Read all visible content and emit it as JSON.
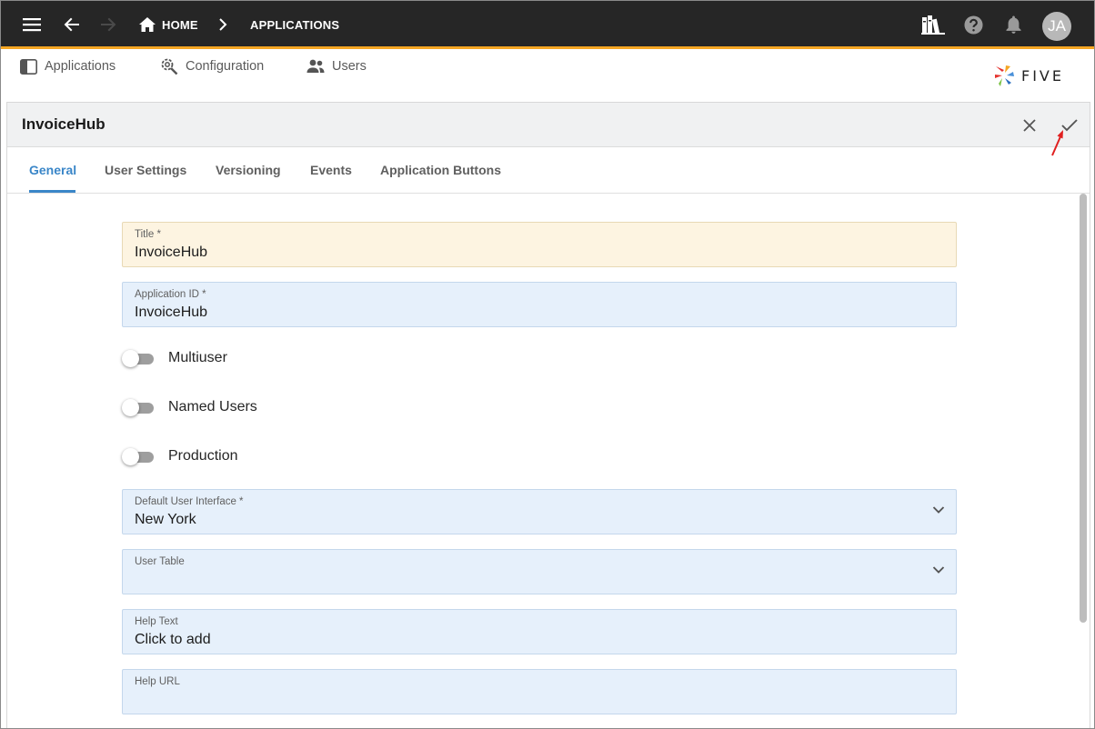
{
  "topbar": {
    "icons": [
      "menu-icon",
      "arrow-back-icon",
      "arrow-forward-icon",
      "home-icon",
      "library-icon",
      "help-icon",
      "notifications-icon"
    ],
    "breadcrumb": {
      "home": "HOME",
      "current": "APPLICATIONS"
    },
    "avatar_initials": "JA",
    "accent_color": "#f5a623"
  },
  "subnav": {
    "items": [
      {
        "label": "Applications",
        "icon": "applications-icon"
      },
      {
        "label": "Configuration",
        "icon": "configuration-icon"
      },
      {
        "label": "Users",
        "icon": "users-icon"
      }
    ],
    "logo_text": "FIVE"
  },
  "panel": {
    "title": "InvoiceHub",
    "actions": [
      "close-icon",
      "check-icon"
    ],
    "tabs": [
      {
        "label": "General",
        "active": true
      },
      {
        "label": "User Settings",
        "active": false
      },
      {
        "label": "Versioning",
        "active": false
      },
      {
        "label": "Events",
        "active": false
      },
      {
        "label": "Application Buttons",
        "active": false
      }
    ],
    "tab_active_color": "#3a86c8"
  },
  "form": {
    "title": {
      "label": "Title *",
      "value": "InvoiceHub"
    },
    "application_id": {
      "label": "Application ID *",
      "value": "InvoiceHub"
    },
    "toggles": [
      {
        "label": "Multiuser",
        "on": false
      },
      {
        "label": "Named Users",
        "on": false
      },
      {
        "label": "Production",
        "on": false
      }
    ],
    "default_ui": {
      "label": "Default User Interface *",
      "value": "New York"
    },
    "user_table": {
      "label": "User Table",
      "value": ""
    },
    "help_text": {
      "label": "Help Text",
      "value": "Click to add"
    },
    "help_url": {
      "label": "Help URL",
      "value": ""
    }
  }
}
